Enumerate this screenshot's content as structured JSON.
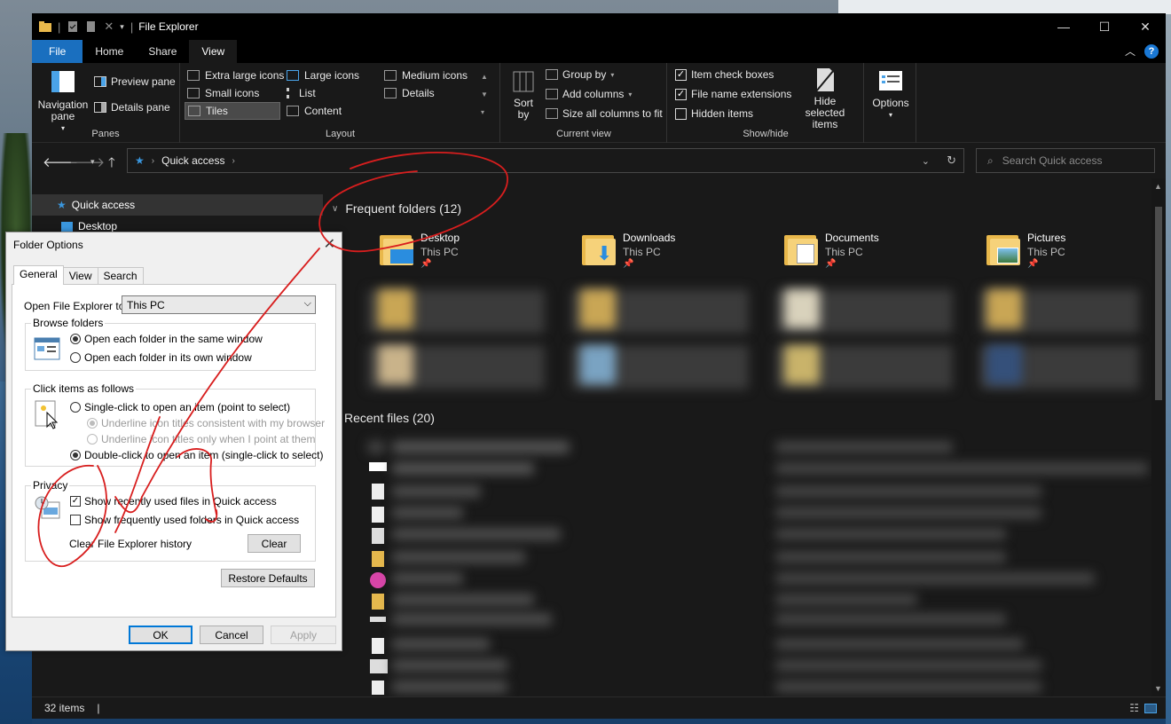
{
  "window": {
    "title": "File Explorer",
    "controls": {
      "minimize": "—",
      "maximize": "☐",
      "close": "✕"
    }
  },
  "ribbon_tabs": [
    "File",
    "Home",
    "Share",
    "View"
  ],
  "ribbon": {
    "panes": {
      "label": "Panes",
      "navigation_pane": "Navigation pane",
      "preview_pane": "Preview pane",
      "details_pane": "Details pane"
    },
    "layout": {
      "label": "Layout",
      "items": [
        "Extra large icons",
        "Large icons",
        "Medium icons",
        "Small icons",
        "List",
        "Details",
        "Tiles",
        "Content"
      ],
      "selected": "Tiles"
    },
    "current_view": {
      "label": "Current view",
      "sort_by": "Sort by",
      "group_by": "Group by",
      "add_columns": "Add columns",
      "size_all_columns": "Size all columns to fit"
    },
    "show_hide": {
      "label": "Show/hide",
      "item_check_boxes": {
        "label": "Item check boxes",
        "checked": true
      },
      "file_name_extensions": {
        "label": "File name extensions",
        "checked": true
      },
      "hidden_items": {
        "label": "Hidden items",
        "checked": false
      },
      "hide_selected_items": "Hide selected items"
    },
    "options": "Options"
  },
  "address": {
    "path": "Quick access",
    "search_placeholder": "Search Quick access"
  },
  "navpane": {
    "items": [
      "Quick access",
      "Desktop"
    ]
  },
  "content": {
    "frequent_header": "Frequent folders (12)",
    "recent_header": "Recent files (20)",
    "folders": [
      {
        "name": "Desktop",
        "location": "This PC"
      },
      {
        "name": "Downloads",
        "location": "This PC"
      },
      {
        "name": "Documents",
        "location": "This PC"
      },
      {
        "name": "Pictures",
        "location": "This PC"
      }
    ]
  },
  "status": {
    "item_count": "32 items"
  },
  "dialog": {
    "title": "Folder Options",
    "tabs": [
      "General",
      "View",
      "Search"
    ],
    "open_to_label": "Open File Explorer to:",
    "open_to_value": "This PC",
    "browse": {
      "legend": "Browse folders",
      "same_window": "Open each folder in the same window",
      "own_window": "Open each folder in its own window"
    },
    "click": {
      "legend": "Click items as follows",
      "single": "Single-click to open an item (point to select)",
      "underline_browser": "Underline icon titles consistent with my browser",
      "underline_point": "Underline icon titles only when I point at them",
      "double": "Double-click to open an item (single-click to select)"
    },
    "privacy": {
      "legend": "Privacy",
      "recent_files": "Show recently used files in Quick access",
      "frequent_folders": "Show frequently used folders in Quick access",
      "clear_history": "Clear File Explorer history",
      "clear_button": "Clear"
    },
    "restore_defaults": "Restore Defaults",
    "ok": "OK",
    "cancel": "Cancel",
    "apply": "Apply"
  },
  "colors": {
    "file_tab": "#1a6fbf",
    "explorer_bg": "#191919",
    "annotation_ink": "#d81e1e"
  }
}
